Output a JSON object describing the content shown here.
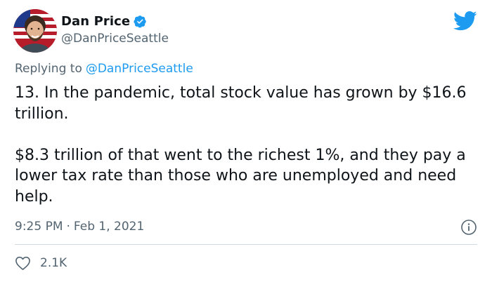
{
  "author": {
    "display_name": "Dan Price",
    "handle": "@DanPriceSeattle",
    "verified": true
  },
  "reply": {
    "prefix": "Replying to",
    "mention": "@DanPriceSeattle"
  },
  "body": {
    "paragraph_1": "13. In the pandemic, total stock value has grown by $16.6 trillion.",
    "paragraph_2": "$8.3 trillion of that went to the richest 1%, and they pay a lower tax rate than those who are unemployed and need help."
  },
  "meta": {
    "time": "9:25 PM",
    "separator": "·",
    "date": "Feb 1, 2021"
  },
  "engagement": {
    "likes": "2.1K"
  },
  "icons": {
    "verified": "verified-badge-icon",
    "brand": "twitter-bird-icon",
    "info": "info-icon",
    "like": "heart-icon"
  },
  "colors": {
    "accent": "#1d9bf0",
    "text": "#0f1419",
    "secondary": "#536471",
    "divider": "#cfd9de"
  }
}
